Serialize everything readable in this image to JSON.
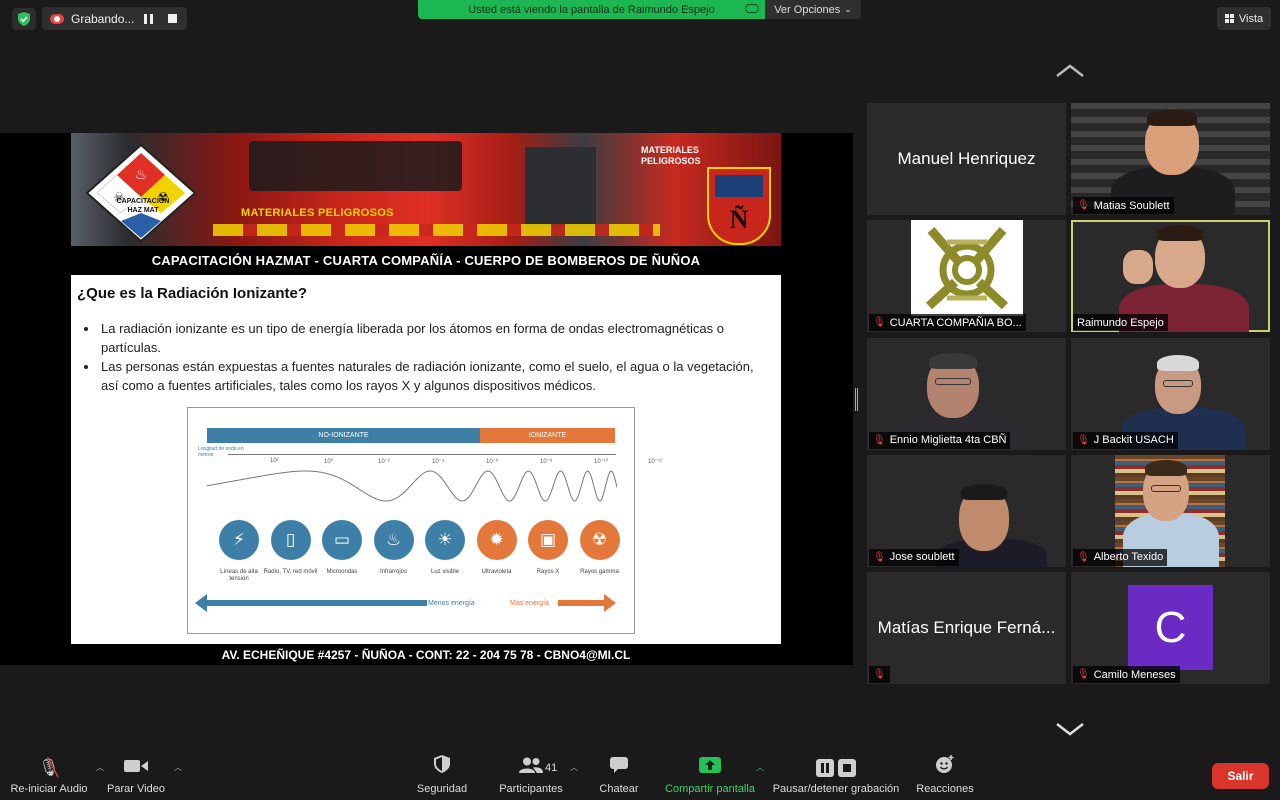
{
  "top": {
    "recording_label": "Grabando...",
    "share_banner": "Usted está viendo la pantalla de Raimundo Espejo",
    "view_options": "Ver Opciones",
    "view_button": "Vista"
  },
  "slide": {
    "hazmat_label": "CAPACITACIÓN HAZ MAT",
    "truck_text": "MATERIALES PELIGROSOS",
    "truck_text2": "MATERIALES PELIGROSOS",
    "crest_letter": "Ñ",
    "header_band": "CAPACITACIÓN HAZMAT  -  CUARTA COMPAÑÍA  -  CUERPO DE BOMBEROS DE ÑUÑOA",
    "title": "¿Que es la Radiación Ionizante?",
    "bullets": [
      "La radiación ionizante es un tipo de energía liberada por los átomos en forma de ondas electromagnéticas o partículas.",
      "Las personas están expuestas a fuentes naturales de radiación ionizante, como el suelo, el agua o la vegetación, así como a fuentes artificiales, tales como los rayos X y algunos dispositivos médicos."
    ],
    "spectrum": {
      "non_ionizing": "NO-IONIZANTE",
      "ionizing": "IONIZANTE",
      "wavelength_label": "Longitud de onda en metros",
      "ticks": [
        "10²",
        "10⁰",
        "10⁻²",
        "10⁻⁴",
        "10⁻⁶",
        "10⁻⁸",
        "10⁻¹⁰",
        "10⁻¹²"
      ],
      "sources": [
        {
          "label": "Líneas de alta tensión",
          "icon": "tower-icon",
          "glyph": "⚡",
          "kind": "b"
        },
        {
          "label": "Radio, TV, red móvil",
          "icon": "phone-icon",
          "glyph": "▯",
          "kind": "b"
        },
        {
          "label": "Microondas",
          "icon": "microwave-icon",
          "glyph": "▭",
          "kind": "b"
        },
        {
          "label": "Infrarrojos",
          "icon": "flame-icon",
          "glyph": "♨",
          "kind": "b"
        },
        {
          "label": "Luz visible",
          "icon": "bulb-icon",
          "glyph": "☀",
          "kind": "b"
        },
        {
          "label": "Ultravioleta",
          "icon": "sun-icon",
          "glyph": "✹",
          "kind": "o"
        },
        {
          "label": "Rayos X",
          "icon": "xray-icon",
          "glyph": "▣",
          "kind": "o"
        },
        {
          "label": "Rayos gamma",
          "icon": "radiation-icon",
          "glyph": "☢",
          "kind": "o"
        }
      ],
      "less_energy": "Menos energía",
      "more_energy": "Más energía"
    },
    "footer_band": "AV. ECHEÑIQUE #4257 - ÑUÑOA  -  CONT:  22 - 204 75 78  -  CBNO4@MI.CL"
  },
  "participants": [
    {
      "name": "Manuel Henriquez",
      "type": "name"
    },
    {
      "name": "Matias Soublett",
      "type": "video"
    },
    {
      "name": "CUARTA COMPAÑIA BO...",
      "type": "logo"
    },
    {
      "name": "Raimundo Espejo",
      "type": "video",
      "active": true
    },
    {
      "name": "Ennio Miglietta 4ta CBÑ",
      "type": "video"
    },
    {
      "name": "J Backit USACH",
      "type": "video"
    },
    {
      "name": "Jose soublett",
      "type": "video"
    },
    {
      "name": "Alberto Texido",
      "type": "video"
    },
    {
      "name": "Matías Enrique Ferná...",
      "type": "name"
    },
    {
      "name": "Camilo Meneses",
      "type": "avatar",
      "initial": "C"
    }
  ],
  "toolbar": {
    "audio": "Re-iniciar Audio",
    "video": "Parar Video",
    "security": "Seguridad",
    "participants": "Participantes",
    "participant_count": "41",
    "chat": "Chatear",
    "share": "Compartir pantalla",
    "pause_recording": "Pausar/detener grabación",
    "reactions": "Reacciones",
    "leave": "Salir"
  }
}
